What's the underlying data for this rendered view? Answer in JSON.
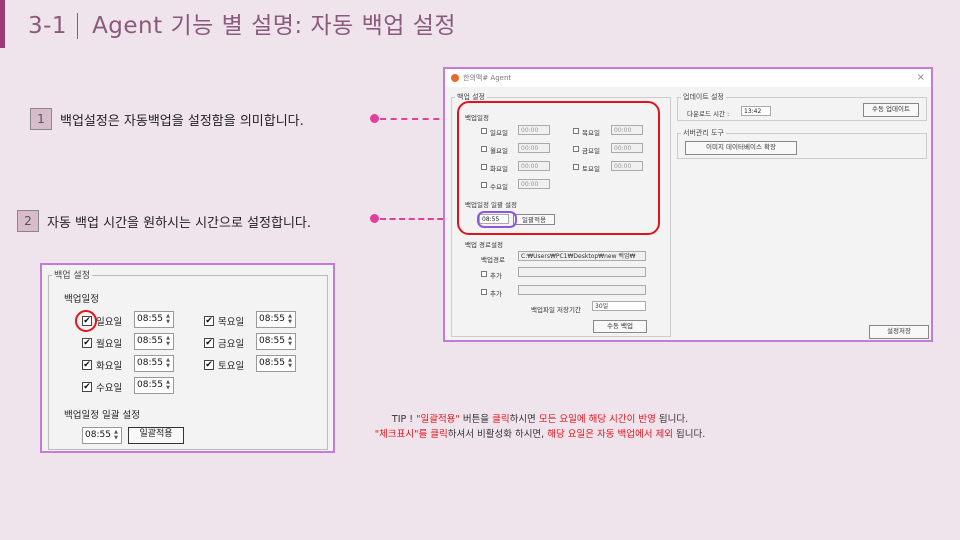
{
  "slide": {
    "number": "3-1",
    "title": "Agent 기능 별 설명: 자동 백업 설정"
  },
  "steps": [
    {
      "badge": "1",
      "text": "백업설정은 자동백업을 설정함을 의미합니다."
    },
    {
      "badge": "2",
      "text": "자동 백업 시간을 원하시는 시간으로 설정합니다."
    }
  ],
  "agent_window": {
    "title": "한의맥# Agent",
    "close_icon": "×",
    "backup_group": "백업 설정",
    "schedule_label": "백업일정",
    "days": [
      {
        "label": "일요일",
        "time": "00:00"
      },
      {
        "label": "월요일",
        "time": "00:00"
      },
      {
        "label": "화요일",
        "time": "00:00"
      },
      {
        "label": "수요일",
        "time": "00:00"
      },
      {
        "label": "목요일",
        "time": "00:00"
      },
      {
        "label": "금요일",
        "time": "00:00"
      },
      {
        "label": "토요일",
        "time": "00:00"
      }
    ],
    "batch_label": "백업일정 일괄 설정",
    "batch_time": "08:55",
    "batch_button": "일괄적용",
    "path_group": "백업 경로설정",
    "path_label": "백업경로",
    "path_value": "C:₩Users₩PC1₩Desktop₩new 백업₩",
    "add_label_1": "추가",
    "add_label_2": "추가",
    "retention_label": "백업파일 저장기간",
    "retention_value": "30일",
    "manual_backup_button": "수동 백업",
    "update_group": "업데이트 설정",
    "download_time_label": "다운로드 시간 :",
    "download_time": "13:42",
    "manual_update_button": "수동 업데이트",
    "server_group": "서버관리 도구",
    "image_db_button": "이미지 데이터베이스 확장",
    "save_button": "설정저장"
  },
  "zoom_panel": {
    "group_label": "백업 설정",
    "schedule_label": "백업일정",
    "check_mark": "✔",
    "days": [
      {
        "label": "일요일",
        "time": "08:55"
      },
      {
        "label": "월요일",
        "time": "08:55"
      },
      {
        "label": "화요일",
        "time": "08:55"
      },
      {
        "label": "수요일",
        "time": "08:55"
      },
      {
        "label": "목요일",
        "time": "08:55"
      },
      {
        "label": "금요일",
        "time": "08:55"
      },
      {
        "label": "토요일",
        "time": "08:55"
      }
    ],
    "batch_label": "백업일정 일괄 설정",
    "batch_time": "08:55",
    "batch_button": "일괄적용"
  },
  "tip": {
    "prefix": "TIP !",
    "q1": "\"일괄적용\"",
    "t1": "버튼을",
    "t2": "클릭",
    "t3": "하시면",
    "r1": "모든 요일에 해당 시간이 반영",
    "t4": "됩니다.",
    "q2": "\"체크표시\"를",
    "t5": "클릭",
    "t6": "하셔서 비활성화 하시면,",
    "r2": "해당 요일은 자동 백업에서 제외",
    "t7": "됩니다."
  },
  "colors": {
    "accent": "#9b3b73",
    "highlight_red": "#e3131b",
    "highlight_purple": "#8a5bd9",
    "connector": "#e0409a",
    "frame": "#c47ad9"
  }
}
